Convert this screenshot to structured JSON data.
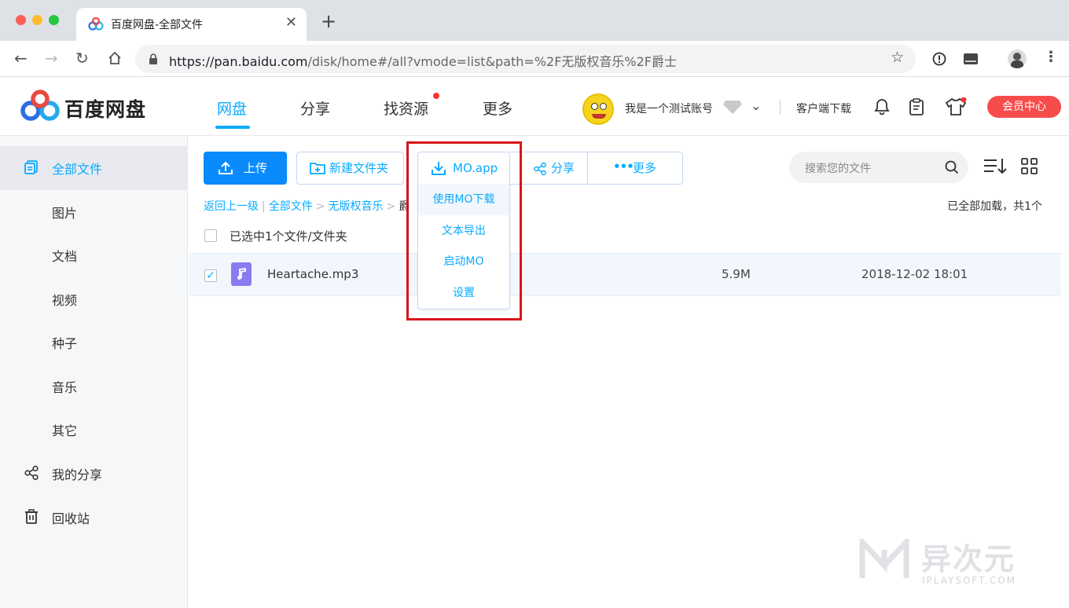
{
  "browser": {
    "tab_title": "百度网盘-全部文件",
    "url_host": "https://pan.baidu.com",
    "url_path": "/disk/home#/all?vmode=list&path=%2F无版权音乐%2F爵士"
  },
  "header": {
    "brand": "百度网盘",
    "nav": [
      "网盘",
      "分享",
      "找资源",
      "更多"
    ],
    "username": "我是一个测试账号",
    "client_download": "客户端下载",
    "vip_button": "会员中心"
  },
  "sidebar": {
    "items": [
      "全部文件",
      "图片",
      "文档",
      "视频",
      "种子",
      "音乐",
      "其它",
      "我的分享",
      "回收站"
    ]
  },
  "toolbar": {
    "upload": "上传",
    "new_folder": "新建文件夹",
    "mo_app": "MO.app",
    "share": "分享",
    "more": "更多",
    "search_placeholder": "搜索您的文件"
  },
  "mo_menu": [
    "使用MO下载",
    "文本导出",
    "启动MO",
    "设置"
  ],
  "breadcrumb": {
    "back": "返回上一级",
    "all": "全部文件",
    "folder": "无版权音乐",
    "current_partial": "爵"
  },
  "status": {
    "loaded": "已全部加载，共1个",
    "selected": "已选中1个文件/文件夹"
  },
  "files": [
    {
      "name": "Heartache.mp3",
      "size": "5.9M",
      "date": "2018-12-02 18:01",
      "checked": true
    }
  ],
  "watermark": {
    "cn": "异次元",
    "en": "IPLAYSOFT.COM"
  },
  "colors": {
    "accent": "#09aaff",
    "vip": "#f74c4c",
    "highlight_box": "#d8151a"
  }
}
